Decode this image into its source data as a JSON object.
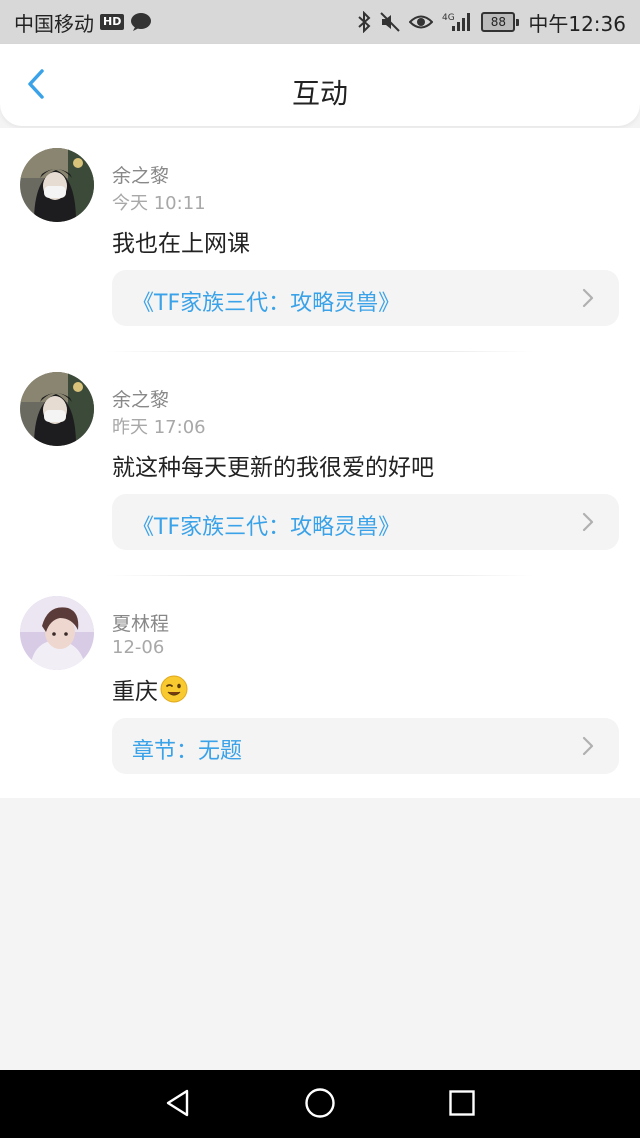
{
  "status_bar": {
    "carrier": "中国移动",
    "hd_badge": "HD",
    "network": "4G",
    "battery_level": "88",
    "time": "中午12:36",
    "icons": [
      "message-bubble-icon",
      "bluetooth-icon",
      "mute-icon",
      "eye-icon",
      "signal-icon",
      "battery-icon"
    ]
  },
  "header": {
    "title": "互动",
    "back_icon": "chevron-left-icon"
  },
  "accent_color": "#3aa2e8",
  "interactions": [
    {
      "username": "余之黎",
      "time": "今天 10:11",
      "comment": "我也在上网课",
      "reference": "《TF家族三代：攻略灵兽》"
    },
    {
      "username": "余之黎",
      "time": "昨天 17:06",
      "comment": "就这种每天更新的我很爱的好吧",
      "reference": "《TF家族三代：攻略灵兽》"
    },
    {
      "username": "夏林程",
      "time": "12-06",
      "comment": "重庆",
      "comment_emoji": "winking-face-emoji",
      "reference": "章节：无题"
    }
  ],
  "system_nav": {
    "buttons": [
      "back-triangle-icon",
      "home-circle-icon",
      "recents-square-icon"
    ]
  }
}
